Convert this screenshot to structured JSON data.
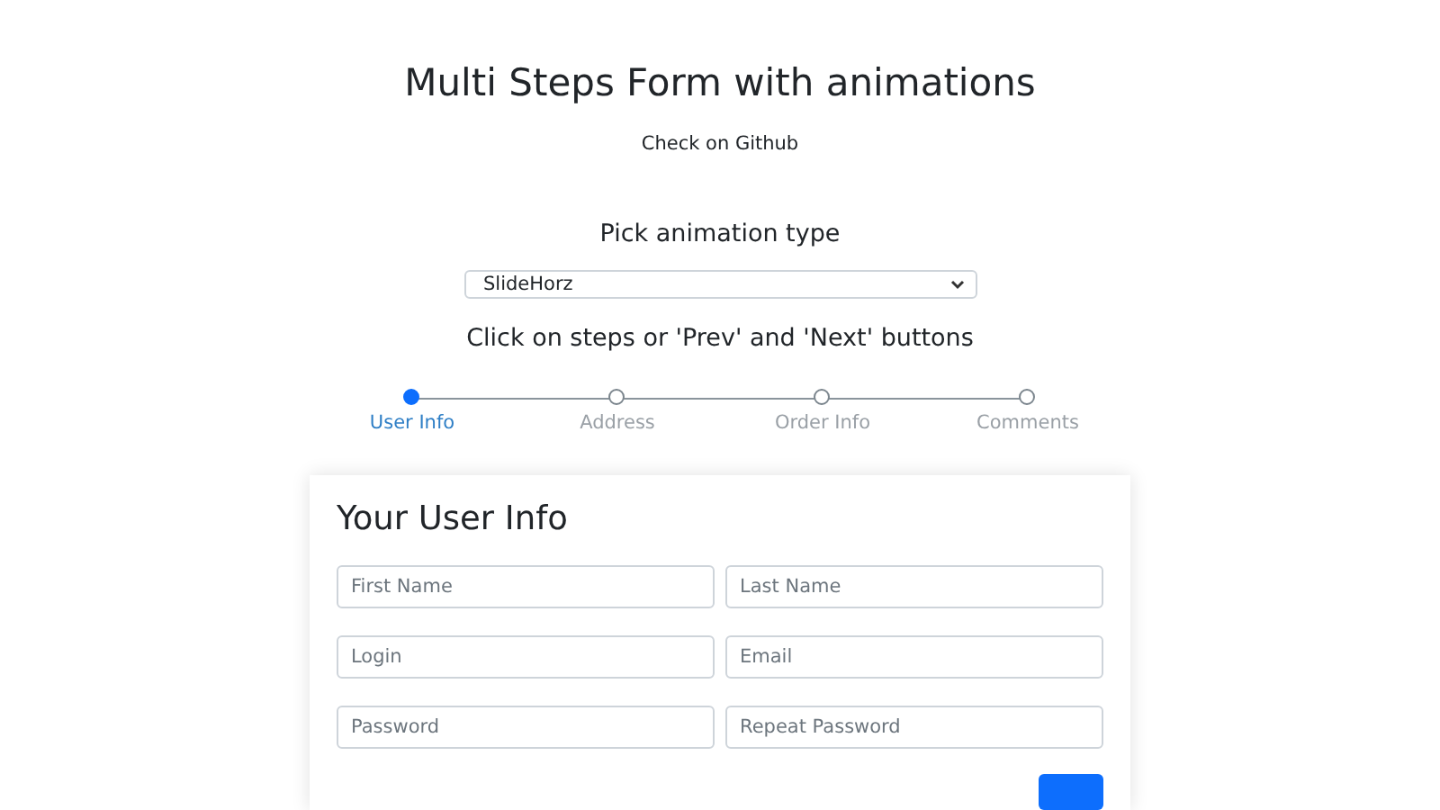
{
  "title": "Multi Steps Form with animations",
  "github_link": "Check on Github",
  "animation_picker": {
    "label": "Pick animation type",
    "value": "SlideHorz"
  },
  "hint": "Click on steps or 'Prev' and 'Next' buttons",
  "steps": [
    {
      "label": "User Info",
      "selected": true
    },
    {
      "label": "Address",
      "selected": false
    },
    {
      "label": "Order Info",
      "selected": false
    },
    {
      "label": "Comments",
      "selected": false
    }
  ],
  "card": {
    "title": "Your User Info",
    "fields": [
      {
        "placeholder": "First Name"
      },
      {
        "placeholder": "Last Name"
      },
      {
        "placeholder": "Login"
      },
      {
        "placeholder": "Email"
      },
      {
        "placeholder": "Password"
      },
      {
        "placeholder": "Repeat Password"
      }
    ]
  }
}
